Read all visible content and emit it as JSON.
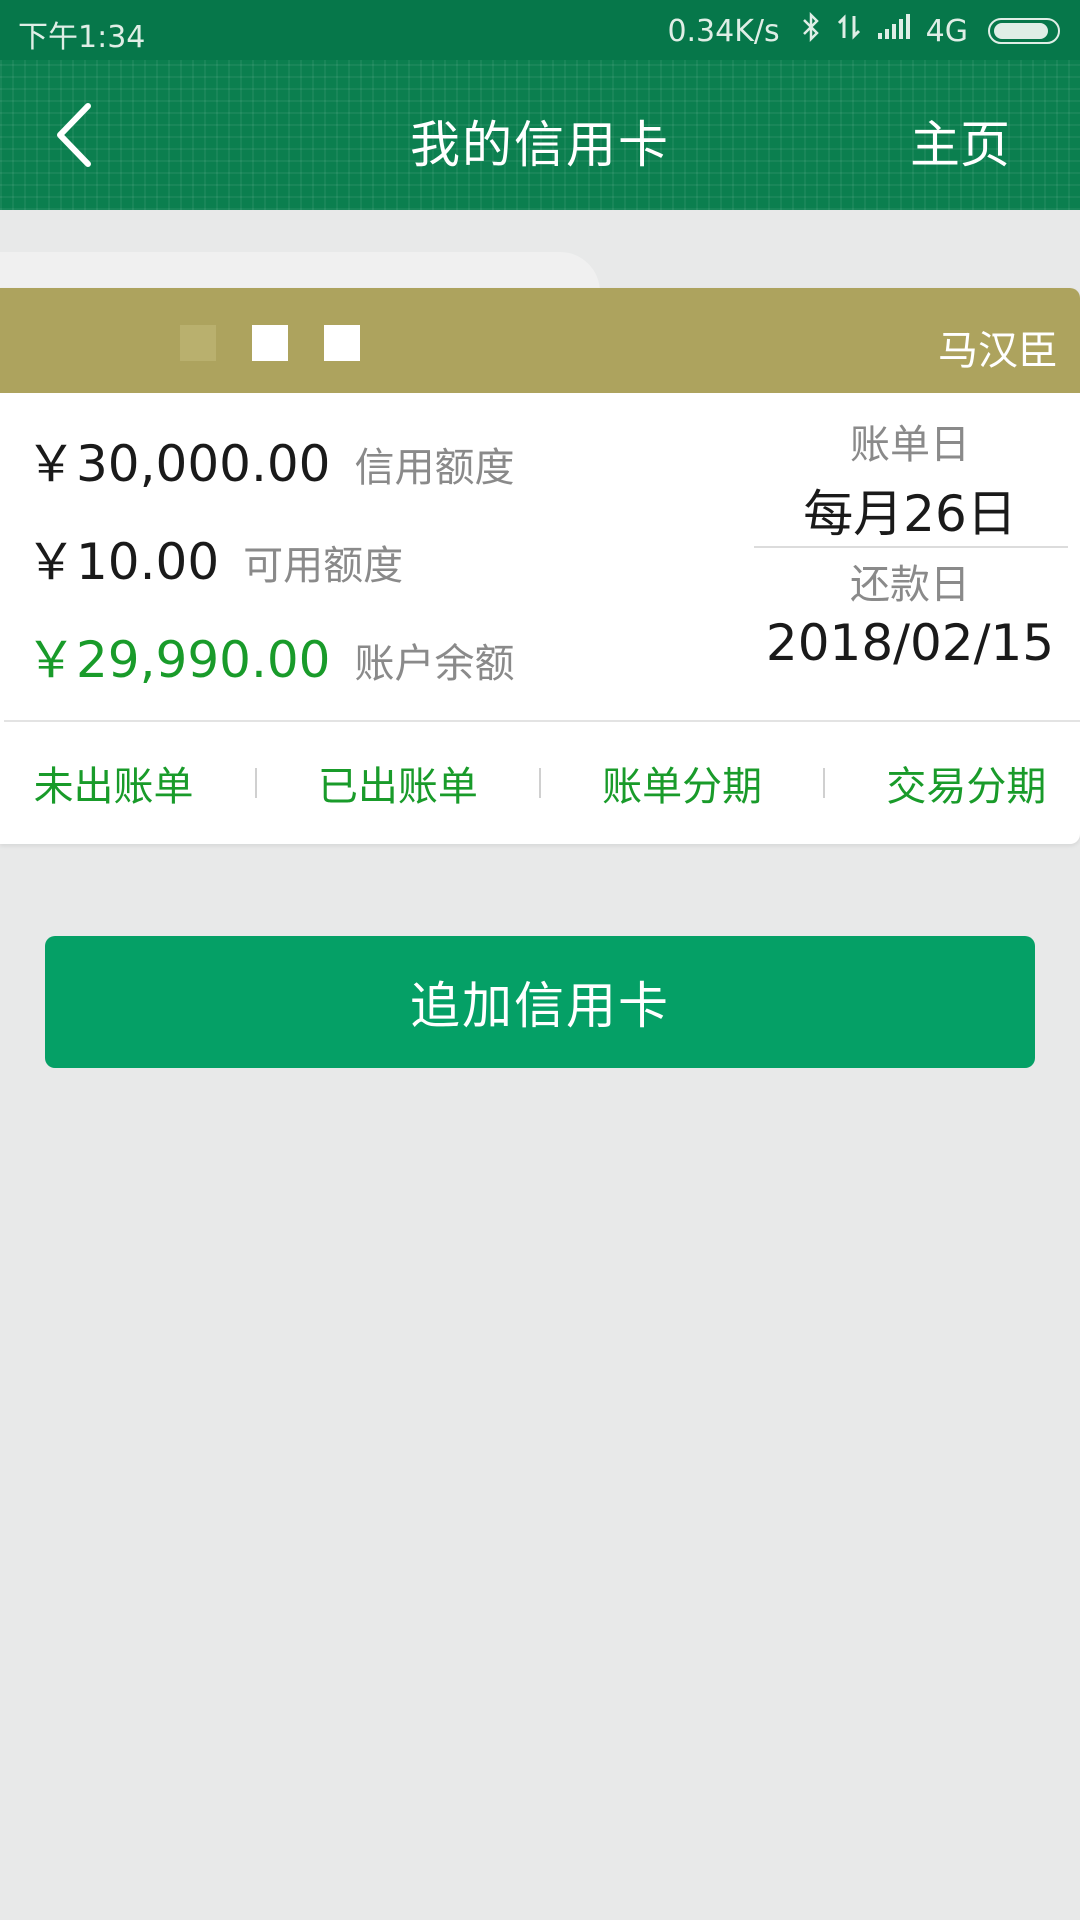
{
  "status_bar": {
    "time": "下午1:34",
    "net_speed": "0.34K/s",
    "network": "4G",
    "icons": [
      "bluetooth-icon",
      "data-transfer-icon",
      "signal-icon",
      "battery-icon"
    ]
  },
  "header": {
    "back_icon": "chevron-left-icon",
    "title": "我的信用卡",
    "home_label": "主页"
  },
  "card": {
    "holder_name": "马汉臣",
    "credit_limit": {
      "value": "￥30,000.00",
      "label": "信用额度"
    },
    "available_limit": {
      "value": "￥10.00",
      "label": "可用额度"
    },
    "account_balance": {
      "value": "￥29,990.00",
      "label": "账户余额"
    },
    "billing_day": {
      "label": "账单日",
      "value": "每月26日"
    },
    "repayment_day": {
      "label": "还款日",
      "value": "2018/02/15"
    },
    "actions": [
      "未出账单",
      "已出账单",
      "账单分期",
      "交易分期"
    ]
  },
  "add_card_label": "追加信用卡",
  "colors": {
    "header_green": "#0b7f4f",
    "status_green": "#06774a",
    "banner_gold": "#ada35e",
    "accent_green": "#199b2a",
    "button_green": "#05a066",
    "page_bg": "#e8e9e9"
  }
}
